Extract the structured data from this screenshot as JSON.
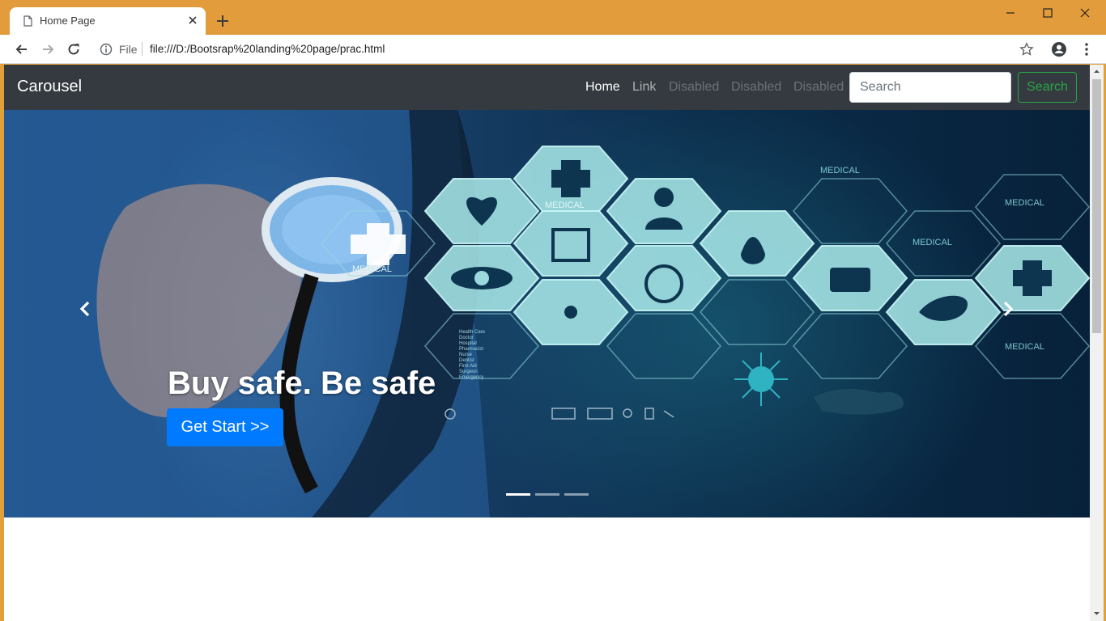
{
  "browser": {
    "tab_title": "Home Page",
    "omnibox": {
      "scheme": "File",
      "url": "file:///D:/Bootsrap%20landing%20page/prac.html"
    },
    "icons": [
      "page-icon",
      "close-icon",
      "plus-icon",
      "minimize-icon",
      "maximize-icon",
      "window-close-icon",
      "back-icon",
      "forward-icon",
      "reload-icon",
      "info-icon",
      "star-icon",
      "account-icon",
      "menu-icon"
    ]
  },
  "page": {
    "navbar": {
      "brand": "Carousel",
      "links": [
        {
          "label": "Home",
          "state": "active"
        },
        {
          "label": "Link",
          "state": "normal"
        },
        {
          "label": "Disabled",
          "state": "disabled"
        },
        {
          "label": "Disabled",
          "state": "disabled"
        },
        {
          "label": "Disabled",
          "state": "disabled"
        }
      ],
      "search_placeholder": "Search",
      "search_button": "Search"
    },
    "carousel": {
      "slide_count": 3,
      "active_slide": 1,
      "caption_title": "Buy safe. Be safe",
      "cta_label": "Get Start >>",
      "image_labels": {
        "medical": "MEDICAL",
        "list": [
          "Health Care",
          "Doctor",
          "Hospital",
          "Pharmacist",
          "Nurse",
          "Dentist",
          "First Aid",
          "Surgeon",
          "Emergency"
        ]
      }
    }
  },
  "colors": {
    "title_bar": "#e29c3b",
    "navbar_bg": "#343a40",
    "primary": "#007bff",
    "success": "#28a745"
  }
}
